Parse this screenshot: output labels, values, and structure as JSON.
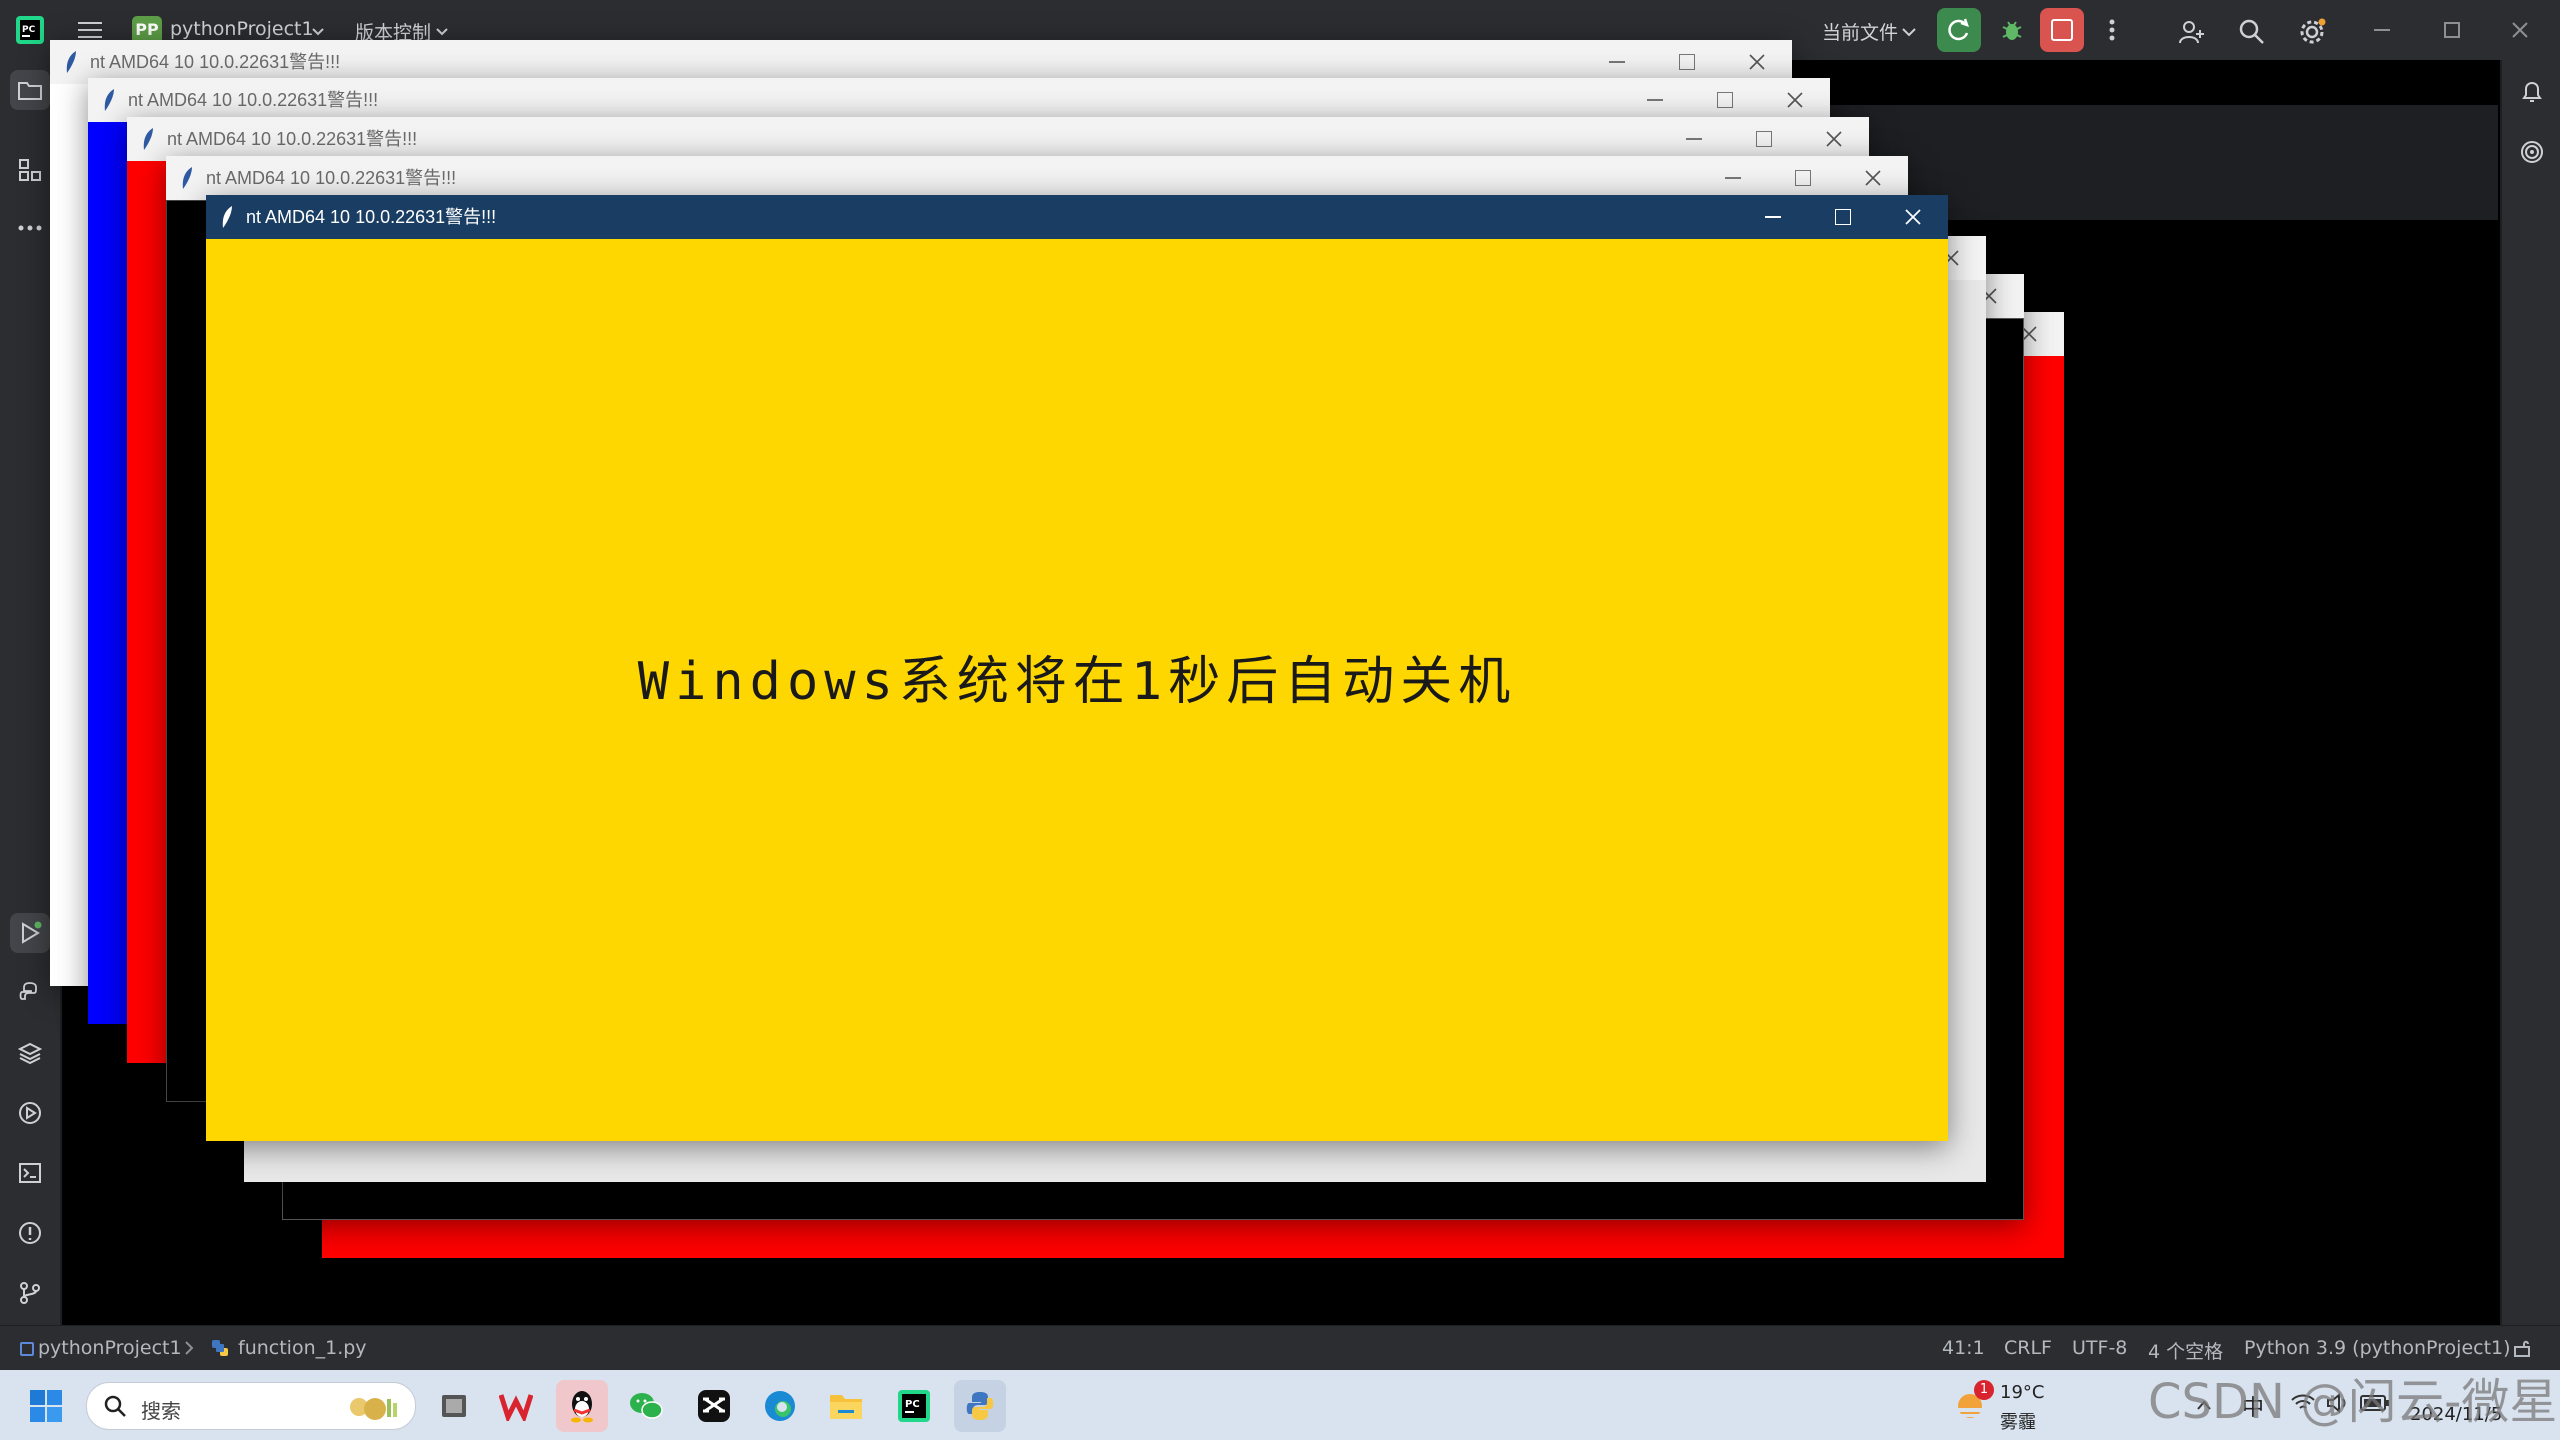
{
  "ide": {
    "project_badge": "PP",
    "project_name": "pythonProject1",
    "vcs_menu": "版本控制",
    "run_config": "当前文件"
  },
  "windows": {
    "title": "nt AMD64 10 10.0.22631警告!!!",
    "message": "Windows系统将在1秒后自动关机"
  },
  "statusbar": {
    "breadcrumb_project": "pythonProject1",
    "breadcrumb_file": "function_1.py",
    "position": "41:1",
    "line_sep": "CRLF",
    "encoding": "UTF-8",
    "indent": "4 个空格",
    "interpreter": "Python 3.9 (pythonProject1)"
  },
  "taskbar": {
    "search_placeholder": "搜索",
    "weather_temp": "19°C",
    "weather_desc": "雾霾",
    "weather_badge": "1",
    "ime": "中",
    "date": "2024/11/5"
  },
  "watermark": "CSDN @闪云-微星",
  "colors": {
    "ide_bg": "#2b2d30",
    "active_titlebar": "#1a3e63",
    "yellow": "#ffd700",
    "red": "#ff0000",
    "blue": "#0000ff",
    "white": "#ffffff",
    "black": "#000000",
    "run_green": "#3d8a4e",
    "stop_red": "#d9534f"
  }
}
